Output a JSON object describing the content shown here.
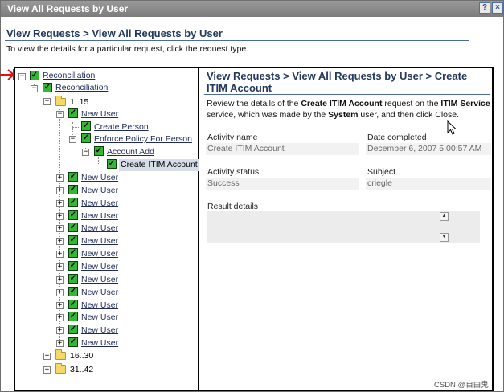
{
  "window": {
    "title": "View All Requests by User",
    "help_label": "?",
    "close_label": "×"
  },
  "header": {
    "title": "View Requests > View All Requests by User",
    "instruction": "To view the details for a particular request, click the request type."
  },
  "tree": {
    "root": "Reconciliation",
    "child": "Reconciliation",
    "folder1": "1..15",
    "new_user": "New User",
    "create_person": "Create Person",
    "enforce_policy": "Enforce Policy For Person",
    "account_add": "Account Add",
    "create_itim_account": "Create ITIM Account",
    "more_new_users": [
      "New User",
      "New User",
      "New User",
      "New User",
      "New User",
      "New User",
      "New User",
      "New User",
      "New User",
      "New User",
      "New User",
      "New User",
      "New User",
      "New User"
    ],
    "folder2": "16..30",
    "folder3": "31..42"
  },
  "details": {
    "title": "View Requests > View All Requests by User > Create ITIM Account",
    "desc_pre": "Review the details of the ",
    "desc_request": "Create ITIM Account",
    "desc_mid1": " request on the ",
    "desc_service": "ITIM Service",
    "desc_mid2": " service, which was made by the ",
    "desc_user": "System",
    "desc_post": " user, and then click Close.",
    "activity_name_label": "Activity name",
    "activity_name_value": "Create ITIM Account",
    "date_completed_label": "Date completed",
    "date_completed_value": "December 6, 2007 5:00:57 AM",
    "activity_status_label": "Activity status",
    "activity_status_value": "Success",
    "subject_label": "Subject",
    "subject_value": "criegle",
    "result_details_label": "Result details"
  },
  "watermark": "CSDN @自由鬼",
  "colors": {
    "title_blue": "#23395e",
    "checkbox_green": "#33b833",
    "marker_red": "#e01010"
  }
}
